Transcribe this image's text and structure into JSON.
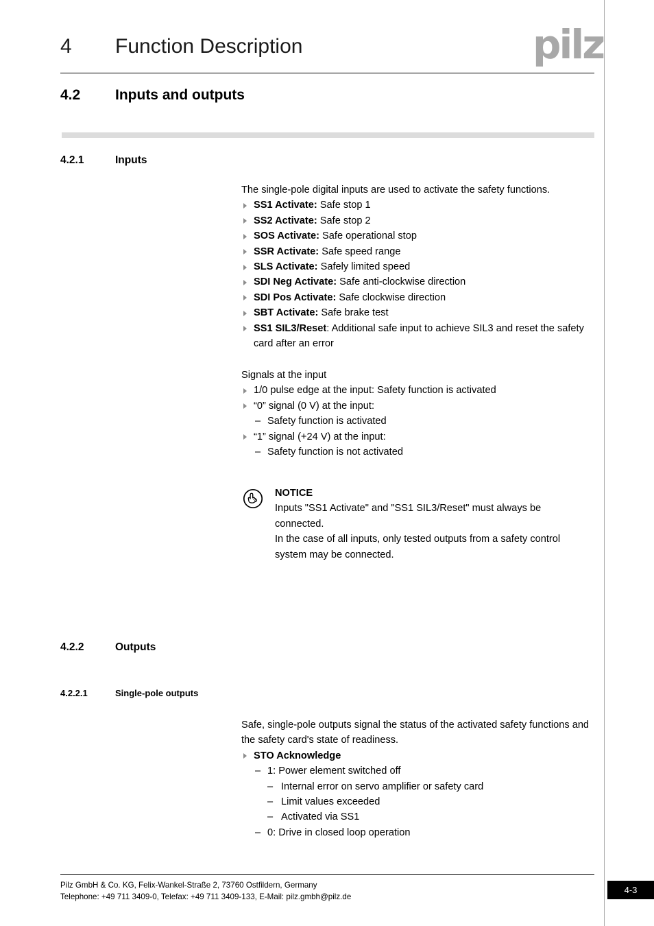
{
  "header": {
    "chapter_number": "4",
    "chapter_title": "Function Description",
    "logo_text": "pilz"
  },
  "sections": {
    "s42": {
      "number": "4.2",
      "title": "Inputs and outputs"
    },
    "s421": {
      "number": "4.2.1",
      "title": "Inputs"
    },
    "s422": {
      "number": "4.2.2",
      "title": "Outputs"
    },
    "s4221": {
      "number": "4.2.2.1",
      "title": "Single-pole outputs"
    }
  },
  "inputs": {
    "intro": "The single-pole digital inputs are used to activate the safety functions.",
    "list": [
      {
        "term": "SS1 Activate:",
        "desc": " Safe stop 1"
      },
      {
        "term": "SS2 Activate:",
        "desc": " Safe stop 2"
      },
      {
        "term": "SOS Activate:",
        "desc": " Safe operational stop"
      },
      {
        "term": "SSR Activate:",
        "desc": " Safe speed range"
      },
      {
        "term": "SLS Activate:",
        "desc": " Safely limited speed"
      },
      {
        "term": "SDI Neg Activate:",
        "desc": " Safe anti-clockwise direction"
      },
      {
        "term": "SDI Pos Activate:",
        "desc": " Safe clockwise direction"
      },
      {
        "term": "SBT Activate:",
        "desc": " Safe brake test"
      },
      {
        "term": "SS1 SIL3/Reset",
        "desc": ": Additional safe input to achieve SIL3 and reset the safety card after an error"
      }
    ],
    "signals_heading": "Signals at the input",
    "signals": [
      {
        "text": "1/0 pulse edge at the input: Safety function is activated",
        "sub": []
      },
      {
        "text": "“0” signal (0 V) at the input:",
        "sub": [
          "Safety function is activated"
        ]
      },
      {
        "text": "“1” signal (+24 V) at the input:",
        "sub": [
          "Safety function is not activated"
        ]
      }
    ]
  },
  "notice": {
    "icon": "pointing-hand-icon",
    "title": "NOTICE",
    "lines": [
      "Inputs \"SS1 Activate\" and \"SS1 SIL3/Reset\" must always be connected.",
      "In the case of all inputs, only tested outputs from a safety control system may be connected."
    ]
  },
  "outputs": {
    "intro": "Safe, single-pole outputs signal the status of the activated safety functions and the safety card's state of readiness.",
    "sto_term": "STO Acknowledge",
    "sto_level2_a": "1: Power element switched off",
    "sto_level3": [
      " Internal error on servo amplifier or safety card",
      "Limit values exceeded",
      "Activated via SS1"
    ],
    "sto_level2_b": "0: Drive in closed loop operation",
    "dash": "–"
  },
  "footer": {
    "line1": "Pilz GmbH & Co. KG, Felix-Wankel-Straße 2, 73760 Ostfildern, Germany",
    "line2": "Telephone: +49 711 3409-0, Telefax: +49 711 3409-133, E-Mail: pilz.gmbh@pilz.de",
    "page_number": "4-3"
  },
  "colors": {
    "logo_gray": "#a8a8a8",
    "bar_gray": "#dcdcdc",
    "bullet_gray": "#8c8c8c",
    "rule_black": "#000000"
  }
}
